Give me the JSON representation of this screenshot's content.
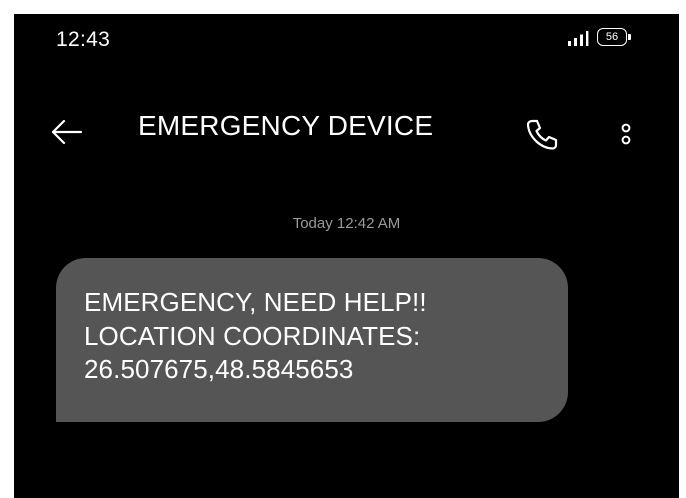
{
  "status_bar": {
    "time": "12:43",
    "battery_level": "56",
    "icons": {
      "signal": "signal-bars-icon",
      "battery": "battery-icon"
    }
  },
  "app_bar": {
    "title": "EMERGENCY DEVICE",
    "icons": {
      "back": "back-arrow-icon",
      "call": "phone-icon",
      "more": "more-vertical-icon"
    }
  },
  "conversation": {
    "timestamp": "Today 12:42 AM",
    "messages": [
      {
        "direction": "incoming",
        "lines": [
          "EMERGENCY, NEED HELP!!",
          "LOCATION COORDINATES:",
          "26.507675,48.5845653"
        ]
      }
    ]
  },
  "colors": {
    "background": "#000000",
    "bubble": "#555555",
    "text": "#ffffff",
    "timestamp": "#9a9a9a",
    "page_frame": "#ffffff"
  }
}
